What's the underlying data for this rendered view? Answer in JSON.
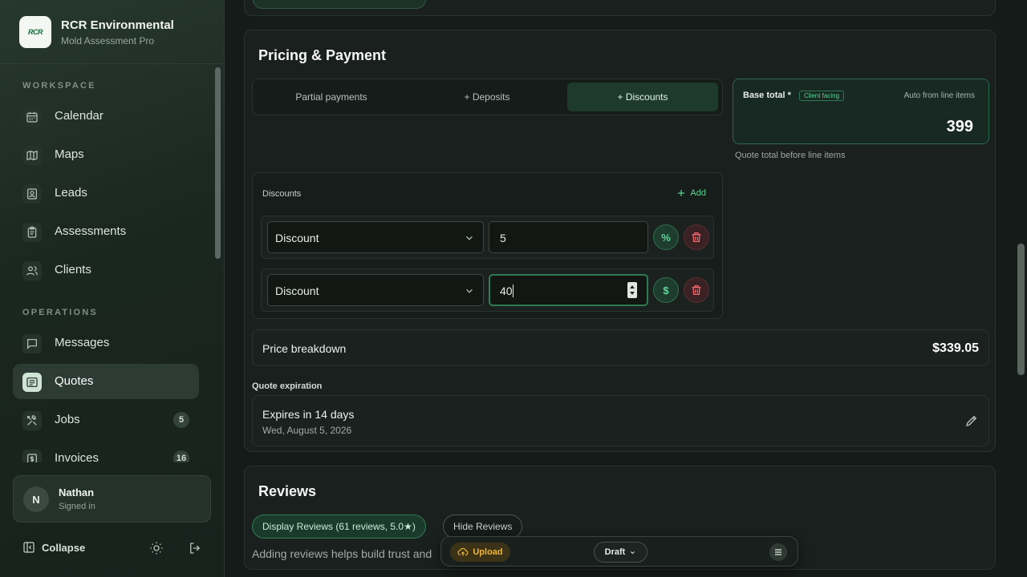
{
  "brand": {
    "logo_text": "RCR",
    "name": "RCR Environmental",
    "subtitle": "Mold Assessment Pro"
  },
  "sidebar": {
    "sections": [
      {
        "label": "WORKSPACE",
        "items": [
          {
            "label": "Calendar",
            "icon": "calendar-icon"
          },
          {
            "label": "Maps",
            "icon": "map-icon"
          },
          {
            "label": "Leads",
            "icon": "contact-card-icon"
          },
          {
            "label": "Assessments",
            "icon": "clipboard-icon"
          },
          {
            "label": "Clients",
            "icon": "users-icon"
          }
        ]
      },
      {
        "label": "OPERATIONS",
        "items": [
          {
            "label": "Messages",
            "icon": "message-icon"
          },
          {
            "label": "Quotes",
            "icon": "quote-icon",
            "active": true
          },
          {
            "label": "Jobs",
            "icon": "tools-icon",
            "badge": "5"
          },
          {
            "label": "Invoices",
            "icon": "invoice-icon",
            "badge": "16"
          }
        ]
      }
    ],
    "user": {
      "initial": "N",
      "name": "Nathan",
      "status": "Signed in"
    },
    "collapse_label": "Collapse"
  },
  "pricing": {
    "title": "Pricing & Payment",
    "tabs": [
      {
        "label": "Partial payments"
      },
      {
        "label": "+ Deposits"
      },
      {
        "label": "+ Discounts",
        "active": true
      }
    ],
    "base_total": {
      "label": "Base total *",
      "chip": "Client facing",
      "auto_label": "Auto from line items",
      "value": "399",
      "help": "Quote total before line items"
    },
    "discounts": {
      "title": "Discounts",
      "add_label": "Add",
      "rows": [
        {
          "type": "Discount",
          "value": "5",
          "mode": "%",
          "mode_icon": "percent-icon"
        },
        {
          "type": "Discount",
          "value": "40",
          "mode": "$",
          "mode_icon": "dollar-icon",
          "focused": true
        }
      ]
    },
    "breakdown": {
      "label": "Price breakdown",
      "value": "$339.05"
    },
    "expiration": {
      "title": "Quote expiration",
      "main": "Expires in 14 days",
      "date": "Wed, August 5, 2026"
    }
  },
  "reviews": {
    "title": "Reviews",
    "display_label": "Display Reviews (61 reviews, 5.0★)",
    "hide_label": "Hide Reviews",
    "help": "Adding reviews helps build trust and"
  },
  "floatbar": {
    "upload_label": "Upload",
    "status_value": "Draft"
  },
  "colors": {
    "accent": "#5dd495",
    "danger": "#f0686f",
    "warning": "#f0b73a"
  }
}
